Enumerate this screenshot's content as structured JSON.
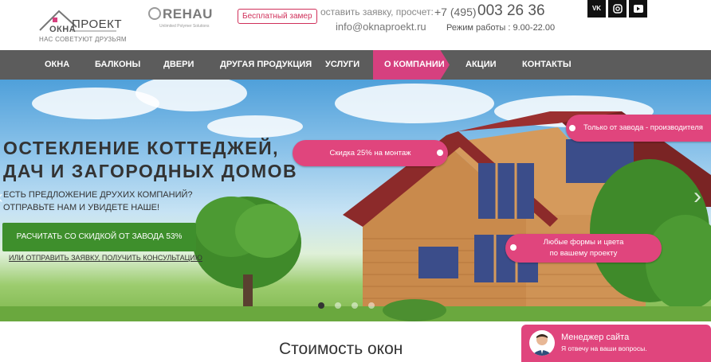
{
  "header": {
    "logo": {
      "word1": "ОКНА",
      "word2": "ПРОЕКТ",
      "tagline": "НАС СОВЕТУЮТ ДРУЗЬЯМ"
    },
    "partner": {
      "name": "REHAU",
      "subtitle": "Unlimited Polymer Solutions"
    },
    "free_measure": "Бесплатный замер",
    "request_text": "оставить заявку, просчет:",
    "phone_prefix": "+7 (495)",
    "phone_number": "003 26 36",
    "email": "info@oknaproekt.ru",
    "hours": "Режим работы : 9.00-22.00",
    "social": [
      {
        "label": "VK",
        "icon": "vk-icon"
      },
      {
        "label": "IG",
        "icon": "instagram-icon"
      },
      {
        "label": "YT",
        "icon": "youtube-icon"
      }
    ]
  },
  "nav": {
    "items": [
      {
        "label": "ОКНА"
      },
      {
        "label": "БАЛКОНЫ"
      },
      {
        "label": "ДВЕРИ"
      },
      {
        "label": "ДРУГАЯ ПРОДУКЦИЯ"
      },
      {
        "label": "УСЛУГИ"
      },
      {
        "label": "О КОМПАНИИ"
      },
      {
        "label": "АКЦИИ"
      },
      {
        "label": "КОНТАКТЫ"
      }
    ],
    "active_index": 5
  },
  "hero": {
    "title_line1": "ОСТЕКЛЕНИЕ КОТТЕДЖЕЙ,",
    "title_line2": "ДАЧ И ЗАГОРОДНЫХ ДОМОВ",
    "sub_line1": "ЕСТЬ ПРЕДЛОЖЕНИЕ ДРУХИХ КОМПАНИЙ?",
    "sub_line2": "ОТПРАВЬТЕ НАМ И УВИДЕТЕ НАШЕ!",
    "cta_button": "РАСЧИТАТЬ СО СКИДКОЙ ОТ ЗАВОДА 53%",
    "cta_link": "ИЛИ ОТПРАВИТЬ ЗАЯВКУ, ПОЛУЧИТЬ КОНСУЛЬТАЦИЮ",
    "badge_discount": "Скидка 25% на монтаж",
    "badge_factory": "Только от завода - производителя",
    "badge_shapes_line1": "Любые формы и цвета",
    "badge_shapes_line2": "по вашему проекту",
    "slides_count": 4,
    "active_slide": 0
  },
  "section": {
    "title": "Стоимость окон"
  },
  "chat": {
    "title": "Менеджер сайта",
    "subtitle": "Я отвечу на ваши вопросы."
  },
  "colors": {
    "accent": "#e0457d",
    "nav_bg": "#5c5c5c",
    "cta_green": "#3e8f2c"
  }
}
